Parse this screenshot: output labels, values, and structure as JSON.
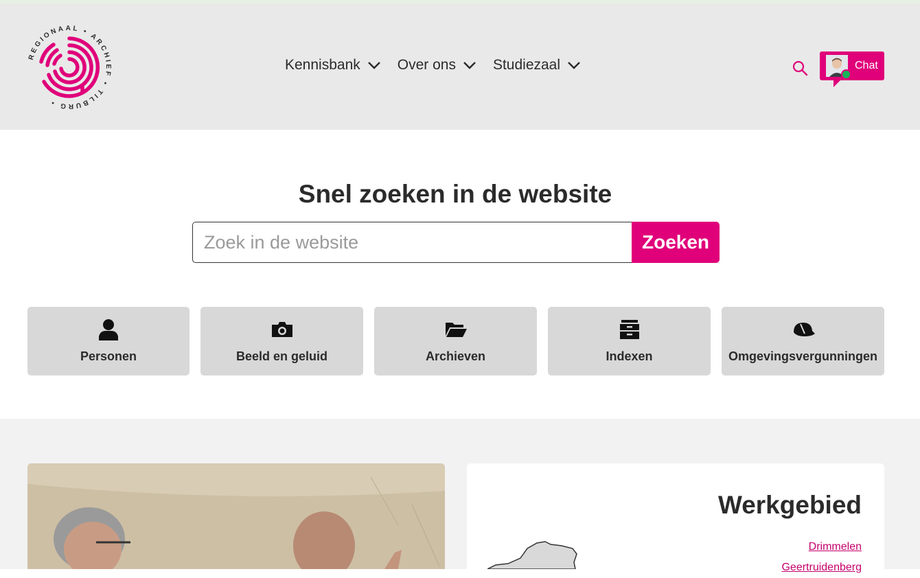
{
  "logo": {
    "ring_text": "REGIONAAL • ARCHIEF • TILBURG •",
    "brand_color": "#e0007a"
  },
  "nav": {
    "items": [
      {
        "label": "Kennisbank"
      },
      {
        "label": "Over ons"
      },
      {
        "label": "Studiezaal"
      }
    ]
  },
  "header": {
    "search_icon": "search-icon",
    "chat_label": "Chat"
  },
  "search": {
    "title": "Snel zoeken in de website",
    "placeholder": "Zoek in de website",
    "value": "",
    "button_label": "Zoeken"
  },
  "tiles": [
    {
      "label": "Personen",
      "icon": "person-icon"
    },
    {
      "label": "Beeld en geluid",
      "icon": "camera-icon"
    },
    {
      "label": "Archieven",
      "icon": "folder-open-icon"
    },
    {
      "label": "Indexen",
      "icon": "archive-box-icon"
    },
    {
      "label": "Omgevingsvergunningen",
      "icon": "hard-hat-icon"
    }
  ],
  "werkgebied": {
    "title": "Werkgebied",
    "links": [
      "Drimmelen",
      "Geertruidenberg"
    ]
  },
  "colors": {
    "accent": "#e0007a",
    "header_bg": "#e9e9e9",
    "tile_bg": "#d8d8d8",
    "lower_bg": "#f2f2f2"
  }
}
